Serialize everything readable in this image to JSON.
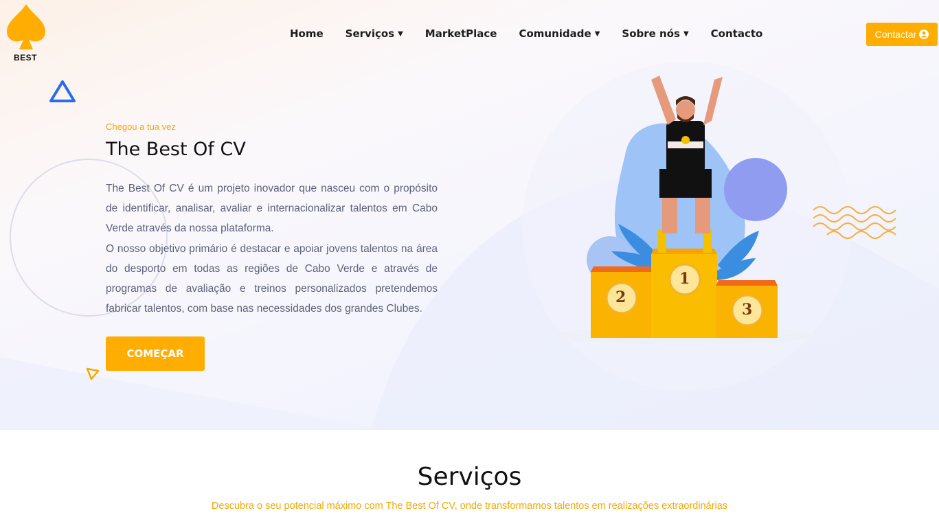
{
  "brand": {
    "logo_text": "BEST"
  },
  "nav": {
    "items": [
      {
        "label": "Home",
        "has_dropdown": false
      },
      {
        "label": "Serviços",
        "has_dropdown": true
      },
      {
        "label": "MarketPlace",
        "has_dropdown": false
      },
      {
        "label": "Comunidade",
        "has_dropdown": true
      },
      {
        "label": "Sobre nós",
        "has_dropdown": true
      },
      {
        "label": "Contacto",
        "has_dropdown": false
      }
    ],
    "contact_button": "Contactar"
  },
  "hero": {
    "eyebrow": "Chegou a tua vez",
    "title": "The Best Of CV",
    "paragraph_1": "The Best Of CV é um projeto inovador que nasceu com o propósito de identificar, analisar, avaliar e internacionalizar talentos em Cabo Verde através da nossa plataforma.",
    "paragraph_2": "O nosso objetivo primário é destacar e apoiar jovens talentos na área do desporto em todas as regiões de Cabo Verde e através de programas de avaliação e treinos personalizados pretendemos fabricar talentos, com base nas necessidades dos grandes Clubes.",
    "cta": "COMEÇAR"
  },
  "podium": {
    "first": "1",
    "second": "2",
    "third": "3"
  },
  "services": {
    "title": "Serviços",
    "subtitle": "Descubra o seu potencial máximo com The Best Of CV, onde transformamos talentos em realizações extraordinárias"
  },
  "colors": {
    "accent": "#ffad00",
    "text_muted": "#5d6278",
    "triangle_blue": "#2a6cf0"
  },
  "icons": [
    "spade-logo-icon",
    "chevron-down-icon",
    "user-circle-icon",
    "triangle-icon",
    "wave-lines-icon"
  ]
}
